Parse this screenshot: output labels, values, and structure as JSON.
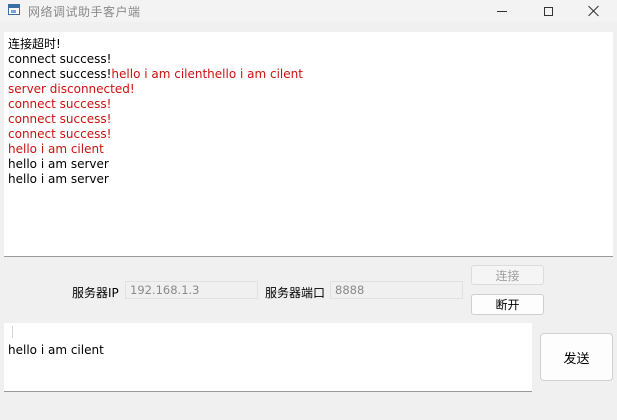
{
  "window": {
    "title": "网络调试助手客户端"
  },
  "log": {
    "lines": [
      {
        "segments": [
          {
            "text": "连接超时!",
            "color": "#000000"
          }
        ]
      },
      {
        "segments": [
          {
            "text": "connect success!",
            "color": "#000000"
          }
        ]
      },
      {
        "segments": [
          {
            "text": "connect success!",
            "color": "#000000"
          },
          {
            "text": "hello i am cilenthello i am cilent",
            "color": "#cc1111"
          }
        ]
      },
      {
        "segments": [
          {
            "text": "server disconnected!",
            "color": "#cc1111"
          }
        ]
      },
      {
        "segments": [
          {
            "text": "connect success!",
            "color": "#cc1111"
          }
        ]
      },
      {
        "segments": [
          {
            "text": "connect success!",
            "color": "#cc1111"
          }
        ]
      },
      {
        "segments": [
          {
            "text": "connect success!",
            "color": "#cc1111"
          }
        ]
      },
      {
        "segments": [
          {
            "text": "hello i am cilent",
            "color": "#cc1111"
          }
        ]
      },
      {
        "segments": [
          {
            "text": "hello i am server",
            "color": "#000000"
          }
        ]
      },
      {
        "segments": [
          {
            "text": "hello i am server",
            "color": "#000000"
          }
        ]
      }
    ]
  },
  "connection": {
    "ip_label": "服务器IP",
    "ip_value": "192.168.1.3",
    "port_label": "服务器端口",
    "port_value": "8888",
    "connect_label": "连接",
    "disconnect_label": "断开"
  },
  "send": {
    "message": "hello i am cilent",
    "send_label": "发送"
  },
  "colors": {
    "error_text": "#cc1111",
    "normal_text": "#000000",
    "disabled_text": "#a0a0a0"
  },
  "icons": {
    "app": "window-app-icon",
    "minimize": "minimize-icon",
    "maximize": "maximize-icon",
    "close": "close-icon"
  }
}
